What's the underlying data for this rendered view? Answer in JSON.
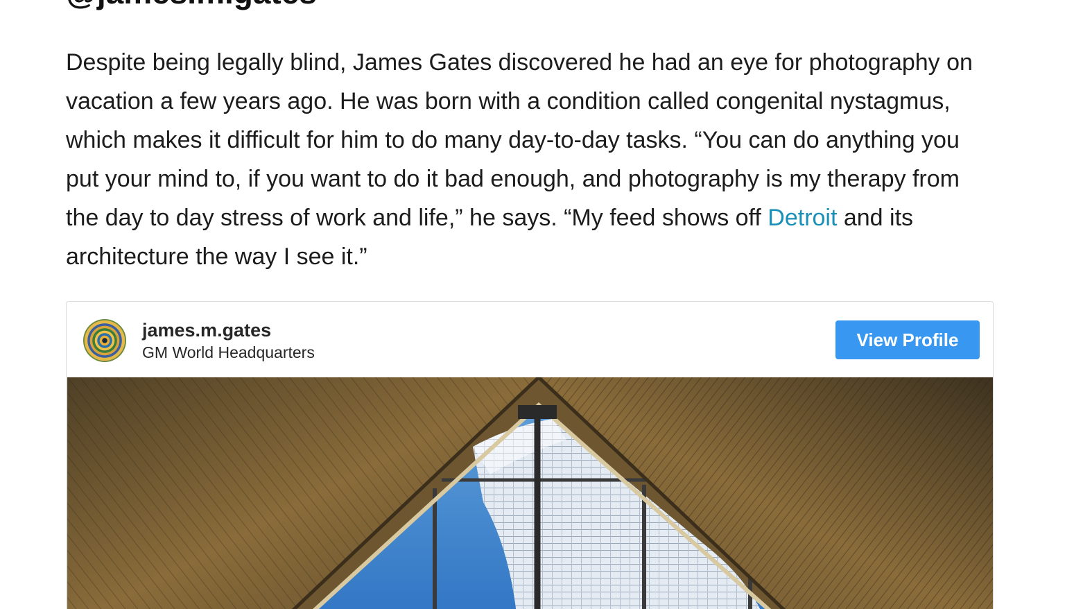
{
  "article": {
    "heading": "@james.m.gates",
    "paragraph_before_link": "Despite being legally blind, James Gates discovered he had an eye for photography on vacation a few years ago. He was born with a condition called congenital nystagmus, which makes it difficult for him to do many day-to-day tasks. “You can do anything you put your mind to, if you want to do it bad enough, and photography is my therapy from the day to day stress of work and life,” he says. “My feed shows off ",
    "link_text": "Detroit",
    "paragraph_after_link": " and its architecture the way I see it.”"
  },
  "embed": {
    "username": "james.m.gates",
    "location": "GM World Headquarters",
    "view_profile_label": "View Profile",
    "avatar_icon": "kaleidoscope-avatar",
    "button_color": "#3897f0"
  },
  "colors": {
    "link": "#1a8fb8",
    "text": "#1c1c1c"
  }
}
